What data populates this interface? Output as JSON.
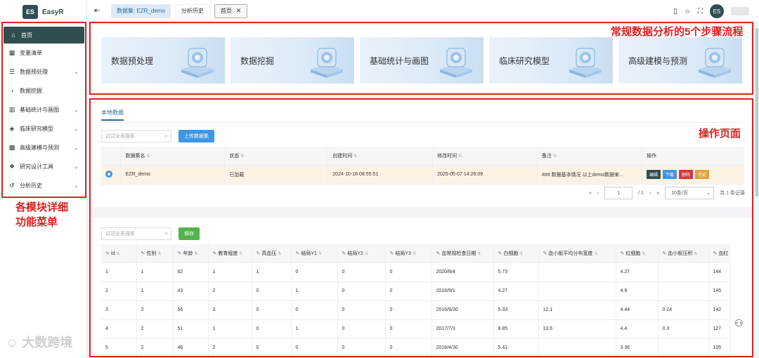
{
  "app": {
    "logo_mark": "ES",
    "title": "EasyR"
  },
  "sidebar": {
    "items": [
      {
        "label": "首页",
        "icon": "home-icon",
        "glyph": "⌂",
        "active": true,
        "expandable": false
      },
      {
        "label": "变量清单",
        "icon": "table-icon",
        "glyph": "▦",
        "active": false,
        "expandable": false
      },
      {
        "label": "数据预处理",
        "icon": "database-icon",
        "glyph": "☰",
        "active": false,
        "expandable": true
      },
      {
        "label": "数据挖掘",
        "icon": "gauge-icon",
        "glyph": "◔",
        "active": false,
        "expandable": false
      },
      {
        "label": "基础统计与画图",
        "icon": "bar-chart-icon",
        "glyph": "▥",
        "active": false,
        "expandable": true
      },
      {
        "label": "临床研究模型",
        "icon": "cube-icon",
        "glyph": "◈",
        "active": false,
        "expandable": true
      },
      {
        "label": "高级建模与预测",
        "icon": "grid-icon",
        "glyph": "▩",
        "active": false,
        "expandable": true
      },
      {
        "label": "研究设计工具",
        "icon": "cubes-icon",
        "glyph": "❖",
        "active": false,
        "expandable": true
      },
      {
        "label": "分析历史",
        "icon": "history-icon",
        "glyph": "↺",
        "active": false,
        "expandable": true
      }
    ]
  },
  "topbar": {
    "tabs": [
      {
        "label": "数据集: EZR_demo",
        "kind": "ds"
      },
      {
        "label": "分析历史",
        "kind": "hist"
      },
      {
        "label": "首页",
        "kind": "home",
        "closable": true
      }
    ],
    "avatar_text": "ES"
  },
  "annotations": {
    "steps": "常规数据分析的5个步骤流程",
    "operation": "操作页面",
    "menu": "各模块详细功能菜单"
  },
  "steps": [
    {
      "label": "数据预处理",
      "icon": "layers-icon"
    },
    {
      "label": "数据挖掘",
      "icon": "cloud-icon"
    },
    {
      "label": "基础统计与画图",
      "icon": "chart-board-icon"
    },
    {
      "label": "临床研究模型",
      "icon": "fan-icon"
    },
    {
      "label": "高级建模与预测",
      "icon": "pyramid-icon"
    }
  ],
  "dataset_panel": {
    "tab": "本地数据",
    "search_placeholder": "试试全表搜索",
    "upload_label": "上传数据集",
    "columns": [
      "数据集名",
      "状态",
      "创建时间",
      "修改时间",
      "备注",
      "操作"
    ],
    "rows": [
      {
        "name": "EZR_demo",
        "status": "已加载",
        "created": "2024-10-16 08:55:51",
        "modified": "2025-05-07 14:26:09",
        "note": "### 数据基本情况 以上demo数据来...",
        "ops": [
          {
            "label": "编辑",
            "color": "#2f4f4f"
          },
          {
            "label": "下载",
            "color": "#3e96e6"
          },
          {
            "label": "删除",
            "color": "#d9363e"
          },
          {
            "label": "历史",
            "color": "#e6a23c"
          }
        ]
      }
    ],
    "pager": {
      "page": "1",
      "total_pages": "/ 1",
      "page_size": "10条/页",
      "total": "共 1 条记录"
    }
  },
  "data_panel": {
    "search_placeholder": "试试全表搜索",
    "save_label": "保存",
    "columns": [
      "id",
      "性别",
      "年龄",
      "教育程度",
      "高血压",
      "结局Y1",
      "结局Y2",
      "结局Y3",
      "血常规检查日期",
      "白细胞",
      "血小板平均分布宽度",
      "红细胞",
      "血小板压积",
      "血红"
    ],
    "rows": [
      [
        "1",
        "1",
        "62",
        "1",
        "1",
        "0",
        "0",
        "0",
        "2020/8/4",
        "5.73",
        "",
        "4.27",
        "",
        "144"
      ],
      [
        "2",
        "1",
        "43",
        "2",
        "0",
        "1",
        "0",
        "0",
        "2016/9/1",
        "4.27",
        "",
        "4.9",
        "",
        "145"
      ],
      [
        "3",
        "2",
        "56",
        "3",
        "0",
        "0",
        "0",
        "0",
        "2016/9/30",
        "5.33",
        "12.1",
        "4.44",
        "0.24",
        "142"
      ],
      [
        "4",
        "2",
        "51",
        "1",
        "0",
        "1",
        "0",
        "0",
        "2017/7/3",
        "8.85",
        "13.6",
        "4.4",
        "0.3",
        "127"
      ],
      [
        "5",
        "2",
        "46",
        "2",
        "0",
        "0",
        "0",
        "0",
        "2018/4/30",
        "5.41",
        "",
        "3.36",
        "",
        "105"
      ]
    ]
  },
  "watermark": "大数跨境",
  "colors": {
    "primary": "#2f4f4f",
    "accent": "#3e96e6",
    "annotation": "#e02020"
  }
}
